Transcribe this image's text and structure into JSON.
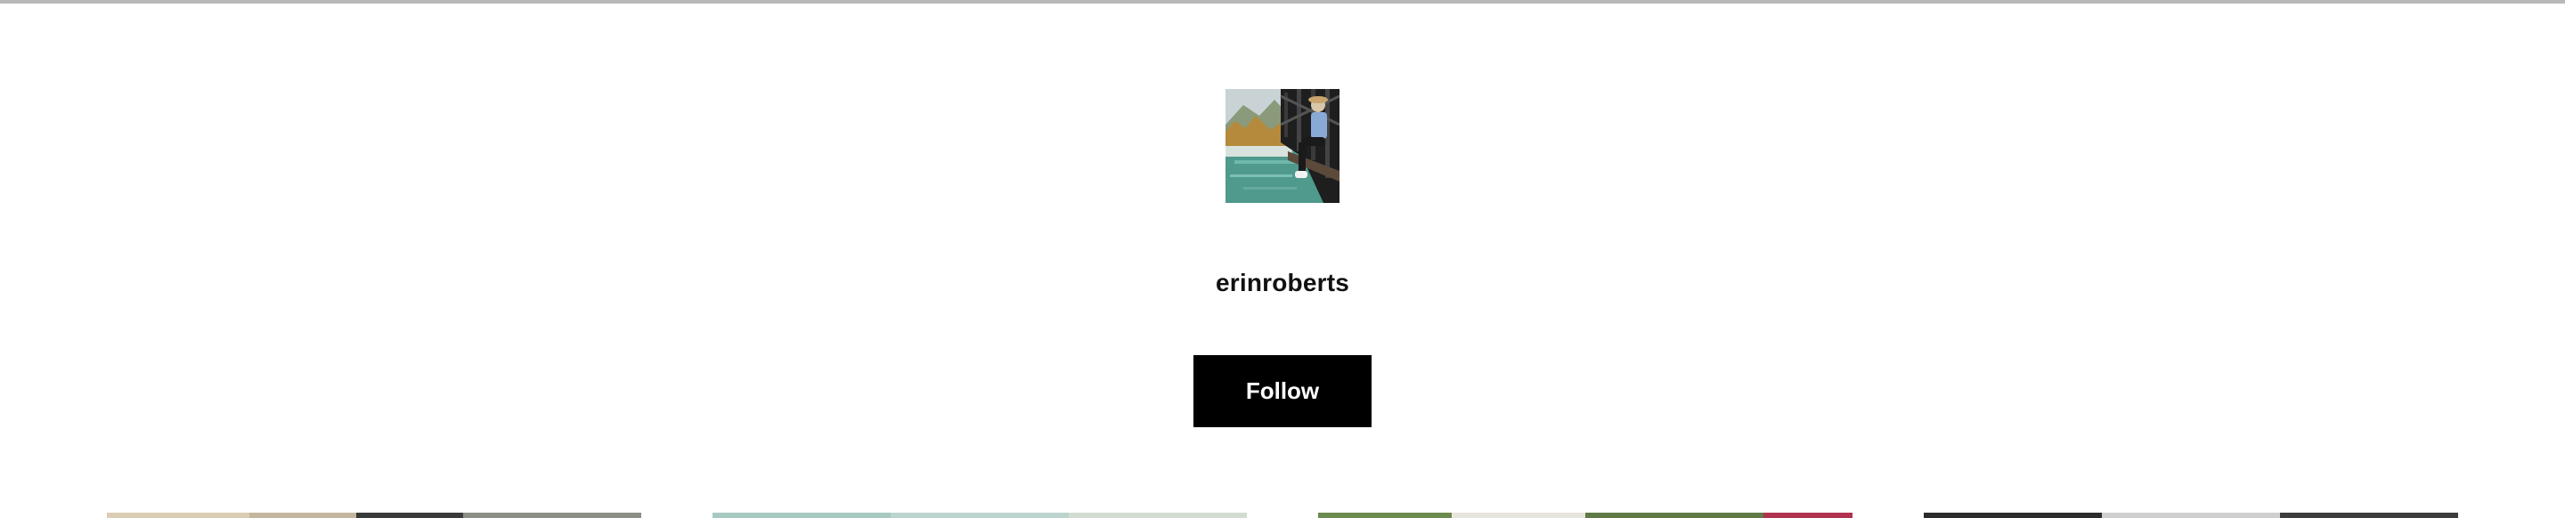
{
  "profile": {
    "username": "erinroberts",
    "avatar_alt": "profile photo",
    "follow_label": "Follow"
  },
  "colors": {
    "follow_button_bg": "#000000",
    "follow_button_text": "#ffffff",
    "top_rule": "#b8b8b8"
  },
  "posts": [
    {
      "label": "post 1"
    },
    {
      "label": "post 2"
    },
    {
      "label": "post 3"
    },
    {
      "label": "post 4"
    }
  ]
}
